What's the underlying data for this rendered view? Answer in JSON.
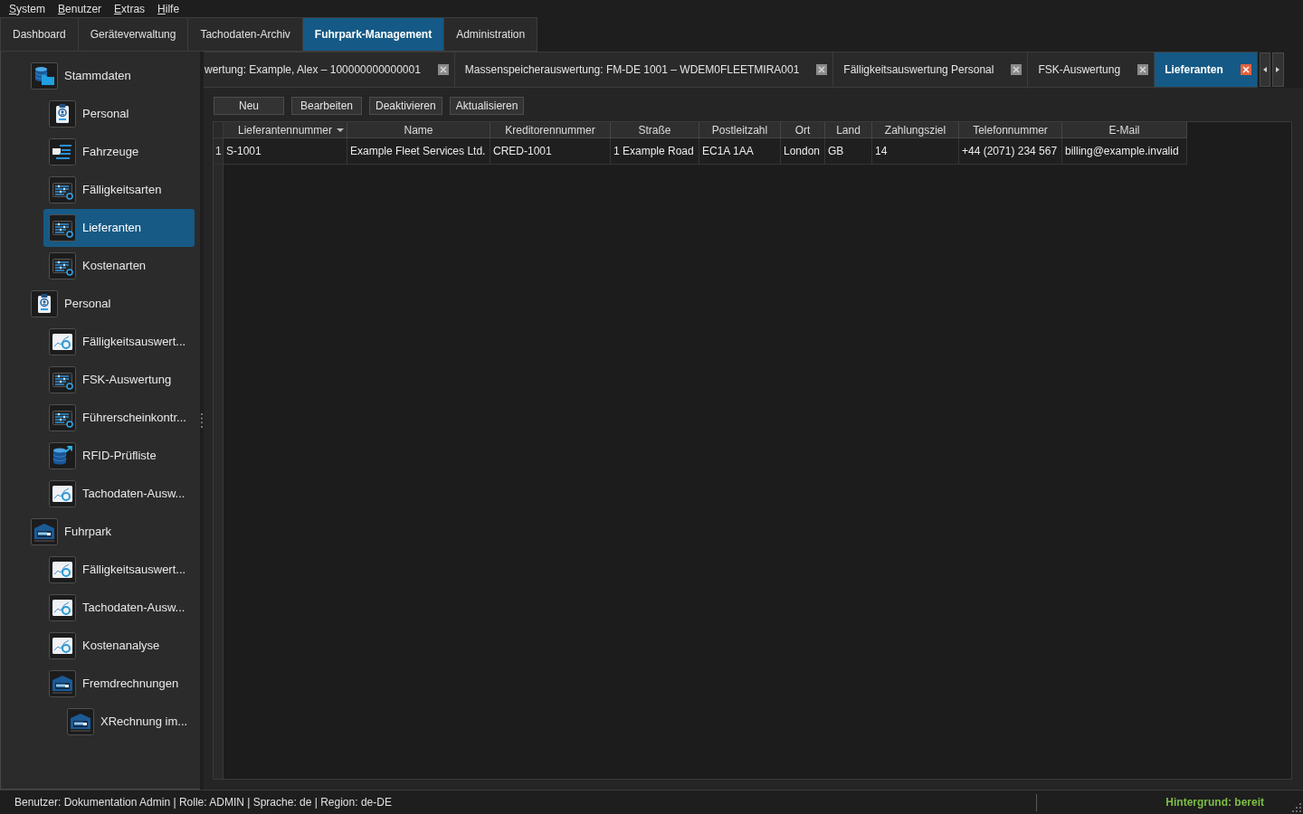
{
  "menu": [
    "System",
    "Benutzer",
    "Extras",
    "Hilfe"
  ],
  "main_tabs": [
    {
      "label": "Dashboard",
      "selected": false
    },
    {
      "label": "Geräteverwaltung",
      "selected": false
    },
    {
      "label": "Tachodaten-Archiv",
      "selected": false
    },
    {
      "label": "Fuhrpark-Management",
      "selected": true
    },
    {
      "label": "Administration",
      "selected": false
    }
  ],
  "sidebar": {
    "items": [
      {
        "label": "Stammdaten",
        "kind": "database",
        "selected": false,
        "children": [
          {
            "label": "Personal",
            "kind": "badge",
            "selected": false
          },
          {
            "label": "Fahrzeuge",
            "kind": "vehicle",
            "selected": false
          },
          {
            "label": "Fälligkeitsarten",
            "kind": "list",
            "selected": false
          },
          {
            "label": "Lieferanten",
            "kind": "list",
            "selected": true
          },
          {
            "label": "Kostenarten",
            "kind": "list",
            "selected": false
          }
        ]
      },
      {
        "label": "Personal",
        "kind": "badge",
        "selected": false,
        "children": [
          {
            "label": "Fälligkeitsauswert...",
            "kind": "chart",
            "selected": false
          },
          {
            "label": "FSK-Auswertung",
            "kind": "list",
            "selected": false
          },
          {
            "label": "Führerscheinkontr...",
            "kind": "list",
            "selected": false
          },
          {
            "label": "RFID-Prüfliste",
            "kind": "rfid",
            "selected": false
          },
          {
            "label": "Tachodaten-Ausw...",
            "kind": "chart",
            "selected": false
          }
        ]
      },
      {
        "label": "Fuhrpark",
        "kind": "garage",
        "selected": false,
        "children": [
          {
            "label": "Fälligkeitsauswert...",
            "kind": "chart",
            "selected": false
          },
          {
            "label": "Tachodaten-Ausw...",
            "kind": "chart",
            "selected": false
          },
          {
            "label": "Kostenanalyse",
            "kind": "chart",
            "selected": false
          },
          {
            "label": "Fremdrechnungen",
            "kind": "garage",
            "selected": false,
            "children": [
              {
                "label": "XRechnung im...",
                "kind": "garage",
                "selected": false
              }
            ]
          }
        ]
      }
    ]
  },
  "document_tabs": [
    {
      "label": "wertung: Example, Alex – 100000000000001",
      "selected": false
    },
    {
      "label": "Massenspeicherauswertung: FM-DE 1001 – WDEM0FLEETMIRA001",
      "selected": false
    },
    {
      "label": "Fälligkeitsauswertung Personal",
      "selected": false
    },
    {
      "label": "FSK-Auswertung",
      "selected": false
    },
    {
      "label": "Lieferanten",
      "selected": true
    }
  ],
  "toolbar": {
    "buttons": [
      "Neu",
      "Bearbeiten",
      "Deaktivieren",
      "Aktualisieren"
    ]
  },
  "table": {
    "columns": [
      {
        "label": "Lieferantennummer",
        "sorted": true
      },
      {
        "label": "Name",
        "sorted": false
      },
      {
        "label": "Kreditorennummer",
        "sorted": false
      },
      {
        "label": "Straße",
        "sorted": false
      },
      {
        "label": "Postleitzahl",
        "sorted": false
      },
      {
        "label": "Ort",
        "sorted": false
      },
      {
        "label": "Land",
        "sorted": false
      },
      {
        "label": "Zahlungsziel",
        "sorted": false
      },
      {
        "label": "Telefonnummer",
        "sorted": false
      },
      {
        "label": "E-Mail",
        "sorted": false
      }
    ],
    "rows": [
      {
        "number": "1",
        "cells": [
          "S-1001",
          "Example Fleet Services Ltd.",
          "CRED-1001",
          "1 Example Road",
          "EC1A 1AA",
          "London",
          "GB",
          "14",
          "+44 (2071) 234 567",
          "billing@example.invalid"
        ]
      }
    ]
  },
  "status_bar": {
    "text": "Benutzer: Dokumentation Admin | Rolle: ADMIN | Sprache: de | Region: de-DE",
    "background": "Hintergrund: bereit"
  }
}
